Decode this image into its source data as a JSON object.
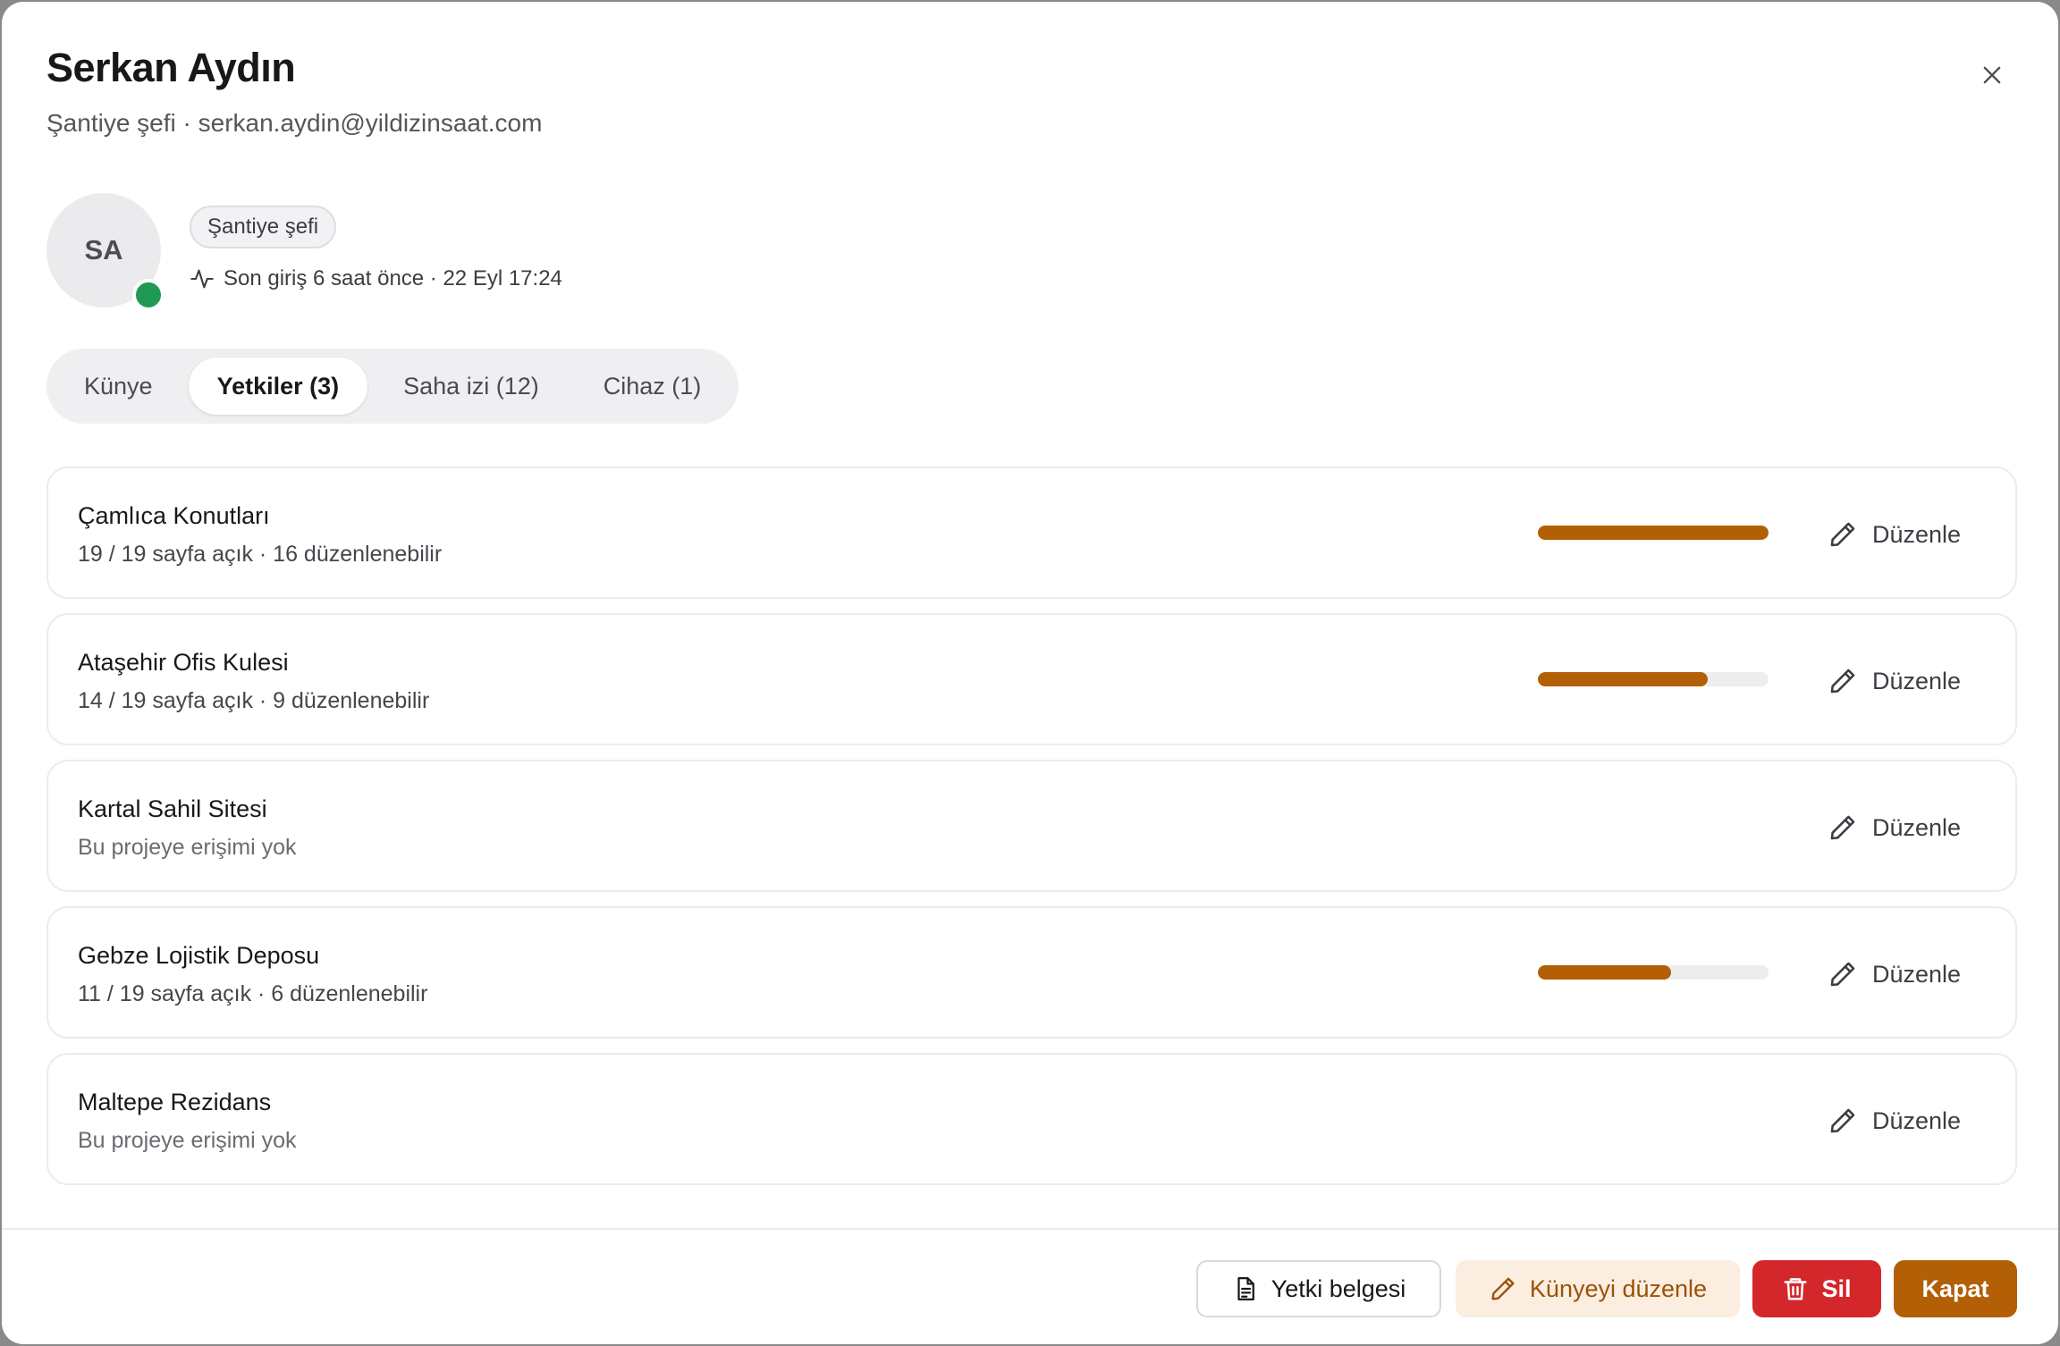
{
  "user": {
    "name": "Serkan Aydın",
    "subtitle": "Şantiye şefi · serkan.aydin@yildizinsaat.com",
    "initials": "SA",
    "role": "Şantiye şefi",
    "last_login": "Son giriş 6 saat önce · 22 Eyl 17:24",
    "status_color": "#1f9a52"
  },
  "tabs": [
    {
      "label": "Künye",
      "active": false
    },
    {
      "label": "Yetkiler (3)",
      "active": true
    },
    {
      "label": "Saha izi (12)",
      "active": false
    },
    {
      "label": "Cihaz (1)",
      "active": false
    }
  ],
  "permissions": [
    {
      "name": "Çamlıca Konutları",
      "meta": "19 / 19 sayfa açık · 16 düzenlenebilir",
      "progress": 1.0,
      "has_access": true,
      "edit_label": "Düzenle"
    },
    {
      "name": "Ataşehir Ofis Kulesi",
      "meta": "14 / 19 sayfa açık · 9 düzenlenebilir",
      "progress": 0.737,
      "has_access": true,
      "edit_label": "Düzenle"
    },
    {
      "name": "Kartal Sahil Sitesi",
      "meta": "Bu projeye erişimi yok",
      "progress": 0,
      "has_access": false,
      "edit_label": "Düzenle"
    },
    {
      "name": "Gebze Lojistik Deposu",
      "meta": "11 / 19 sayfa açık · 6 düzenlenebilir",
      "progress": 0.579,
      "has_access": true,
      "edit_label": "Düzenle"
    },
    {
      "name": "Maltepe Rezidans",
      "meta": "Bu projeye erişimi yok",
      "progress": 0,
      "has_access": false,
      "edit_label": "Düzenle"
    }
  ],
  "footer": {
    "doc_label": "Yetki belgesi",
    "edit_label": "Künyeyi düzenle",
    "delete_label": "Sil",
    "close_label": "Kapat"
  },
  "colors": {
    "accent": "#b35f06",
    "danger": "#d4272b",
    "online": "#1f9a52"
  },
  "icons": {
    "close": "close-icon",
    "activity": "activity-icon",
    "edit": "pencil-icon",
    "document": "document-icon",
    "delete": "trash-icon"
  }
}
